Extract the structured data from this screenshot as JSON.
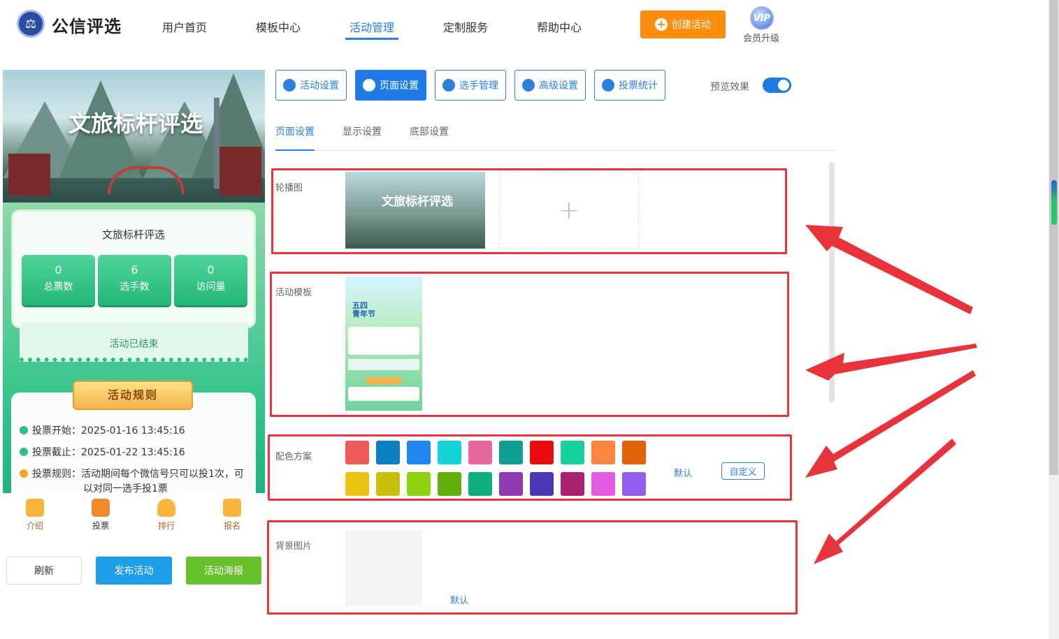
{
  "header": {
    "logo_text": "公信评选",
    "nav": [
      "用户首页",
      "模板中心",
      "活动管理",
      "定制服务",
      "帮助中心"
    ],
    "create_button": "创建活动",
    "vip_badge": "VIP",
    "vip_label": "会员升级"
  },
  "preview": {
    "banner_title": "文旅标杆评选",
    "card_title": "文旅标杆评选",
    "stats": [
      {
        "value": "0",
        "label": "总票数"
      },
      {
        "value": "6",
        "label": "选手数"
      },
      {
        "value": "0",
        "label": "访问量"
      }
    ],
    "status": "活动已结束",
    "rules_title": "活动规则",
    "rules": [
      {
        "label": "投票开始：",
        "value": "2025-01-16 13:45:16"
      },
      {
        "label": "投票截止：",
        "value": "2025-01-22 13:45:16"
      },
      {
        "label": "投票规则：",
        "value": "活动期间每个微信号只可以投1次，可",
        "value2": "以对同一选手投1票"
      }
    ],
    "tabbar": [
      "介绍",
      "投票",
      "排行",
      "报名"
    ],
    "buttons": {
      "refresh": "刷新",
      "publish": "发布活动",
      "poster": "活动海报"
    }
  },
  "settings": {
    "top_tabs": [
      "活动设置",
      "页面设置",
      "选手管理",
      "高级设置",
      "投票统计"
    ],
    "preview_label": "预览效果",
    "sub_tabs": [
      "页面设置",
      "显示设置",
      "底部设置"
    ],
    "carousel_label": "轮播图",
    "carousel_image_text": "文旅标杆评选",
    "add_symbol": "+",
    "template_label": "活动模板",
    "template_text": "五四\n青年节",
    "color_label": "配色方案",
    "colors_row1": [
      "#f05a5a",
      "#0a7fbf",
      "#1e88f0",
      "#12d3d6",
      "#e8689c",
      "#0e9e92",
      "#e80c0c",
      "#16d1a0",
      "#fb8440",
      "#e06406"
    ],
    "colors_row2": [
      "#ecc414",
      "#c9c00c",
      "#8ed212",
      "#64ae0c",
      "#0eaf7c",
      "#8e3ab0",
      "#4a38b6",
      "#a8216e",
      "#e35ae3",
      "#9060ec"
    ],
    "default_link": "默认",
    "custom_button": "自定义",
    "bg_label": "背景图片",
    "bg_default_link": "默认"
  },
  "colors": {
    "accent": "#1e7be6",
    "orange": "#fb8c0c",
    "annotation_red": "#e8333b",
    "publish_blue": "#1e9ee8",
    "poster_green": "#68c02c"
  }
}
